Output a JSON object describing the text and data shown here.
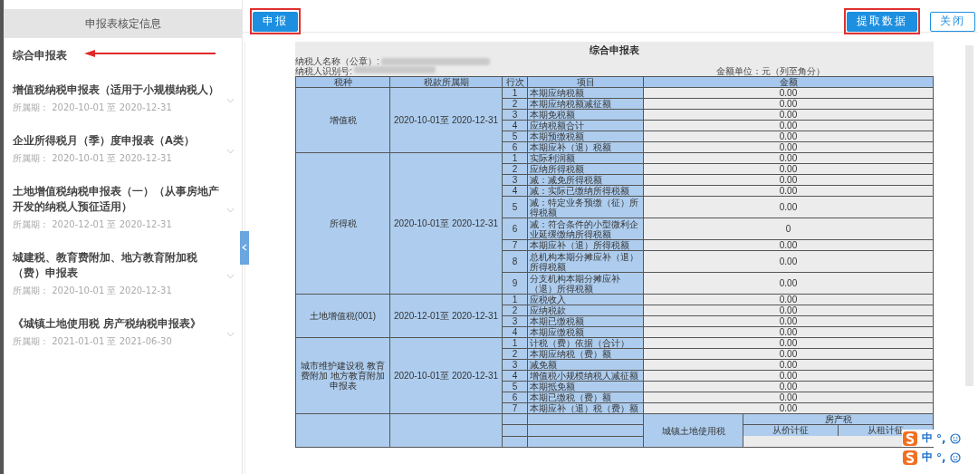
{
  "sidebar": {
    "title": "申报表核定信息",
    "items": [
      {
        "title": "综合申报表",
        "annotated": true
      },
      {
        "title": "增值税纳税申报表（适用于小规模纳税人）",
        "period_label": "所属期：",
        "period": "2020-10-01 至 2020-12-31"
      },
      {
        "title": "企业所得税月（季）度申报表（A类）",
        "period_label": "所属期：",
        "period": "2020-10-01 至 2020-12-31"
      },
      {
        "title": "土地增值税纳税申报表（一）（从事房地产开发的纳税人预征适用）",
        "period_label": "所属期：",
        "period": "2020-12-01 至 2020-12-31"
      },
      {
        "title": "城建税、教育费附加、地方教育附加税（费）申报表",
        "period_label": "所属期：",
        "period": "2020-10-01 至 2020-12-31"
      },
      {
        "title": "《城镇土地使用税 房产税纳税申报表》",
        "period_label": "所属期：",
        "period": "2021-01-01 至 2021-06-30"
      }
    ]
  },
  "toolbar": {
    "left_buttons": [
      {
        "label": "申报",
        "kind": "primary",
        "annotated": true
      }
    ],
    "right_buttons": [
      {
        "label": "提取数据",
        "kind": "primary",
        "annotated": true
      },
      {
        "label": "关闭",
        "kind": "outline",
        "annotated": false
      }
    ]
  },
  "report": {
    "title": "综合申报表",
    "taxpayer_name_label": "纳税人名称（公章）:",
    "taxpayer_id_label": "纳税人识别号:",
    "unit": "金额单位：元（列至角分）",
    "columns": [
      "税种",
      "税款所属期",
      "行次",
      "项目",
      "金额"
    ],
    "groups": [
      {
        "tax": "增值税",
        "period": "2020-10-01至 2020-12-31",
        "rows": [
          {
            "no": "1",
            "item": "本期应纳税额",
            "amount": "0.00"
          },
          {
            "no": "2",
            "item": "本期应纳税额减征额",
            "amount": "0.00"
          },
          {
            "no": "3",
            "item": "本期免税额",
            "amount": "0.00"
          },
          {
            "no": "4",
            "item": "应纳税额合计",
            "amount": "0.00"
          },
          {
            "no": "5",
            "item": "本期预缴税额",
            "amount": "0.00"
          },
          {
            "no": "6",
            "item": "本期应补（退）税额",
            "amount": "0.00"
          }
        ]
      },
      {
        "tax": "所得税",
        "period": "2020-10-01至 2020-12-31",
        "rows": [
          {
            "no": "1",
            "item": "实际利润额",
            "amount": "0.00"
          },
          {
            "no": "2",
            "item": "应纳所得税额",
            "amount": "0.00"
          },
          {
            "no": "3",
            "item": "减：减免所得税额",
            "amount": "0.00"
          },
          {
            "no": "4",
            "item": "减：实际已缴纳所得税额",
            "amount": "0.00"
          },
          {
            "no": "5",
            "item": "减：特定业务预缴（征）所得税额",
            "amount": "0.00"
          },
          {
            "no": "6",
            "item": "减：符合条件的小型微利企业延缓缴纳所得税额",
            "amount": "0"
          },
          {
            "no": "7",
            "item": "本期应补（退）所得税额",
            "amount": "0.00"
          },
          {
            "no": "8",
            "item": "总机构本期分摊应补（退）所得税额",
            "amount": "0.00"
          },
          {
            "no": "9",
            "item": "分支机构本期分摊应补（退）所得税额",
            "amount": "0.00"
          }
        ]
      },
      {
        "tax": "土地增值税(001)",
        "period": "2020-12-01至 2020-12-31",
        "rows": [
          {
            "no": "1",
            "item": "应税收入",
            "amount": "0.00"
          },
          {
            "no": "2",
            "item": "应纳税款",
            "amount": "0.00"
          },
          {
            "no": "3",
            "item": "本期已缴税额",
            "amount": "0.00"
          },
          {
            "no": "4",
            "item": "本期应缴税额",
            "amount": "0.00"
          }
        ]
      },
      {
        "tax": "城市维护建设税 教育费附加 地方教育附加申报表",
        "period": "2020-10-01至 2020-12-31",
        "rows": [
          {
            "no": "1",
            "item": "计税（费）依据（合计）",
            "amount": "0.00"
          },
          {
            "no": "2",
            "item": "本期应纳税（费）额",
            "amount": "0.00"
          },
          {
            "no": "3",
            "item": "减免额",
            "amount": "0.00"
          },
          {
            "no": "4",
            "item": "增值税小规模纳税人减征额",
            "amount": "0.00"
          },
          {
            "no": "5",
            "item": "本期抵免额",
            "amount": "0.00"
          },
          {
            "no": "6",
            "item": "本期已缴税（费）额",
            "amount": "0.00"
          },
          {
            "no": "7",
            "item": "本期应补（退）税（费）额",
            "amount": "0.00"
          }
        ]
      }
    ],
    "subheader": {
      "land_use_tax": "城镇土地使用税",
      "property_tax": "房产税",
      "by_value": "从价计征",
      "by_rent": "从租计征"
    }
  },
  "ime_toolbars": [
    {
      "mode": "中",
      "punct": "°,"
    },
    {
      "mode": "中",
      "punct": "°,"
    }
  ]
}
